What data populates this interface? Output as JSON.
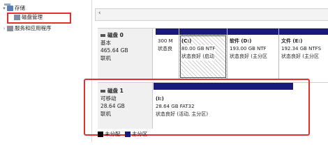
{
  "tree": {
    "items": [
      {
        "label": "存储"
      },
      {
        "label": "磁盘管理"
      },
      {
        "label": "服务和应用程序"
      }
    ]
  },
  "disks": [
    {
      "name": "磁盘 0",
      "type": "基本",
      "size": "465.64 GB",
      "status": "联机",
      "partitions": [
        {
          "title": "",
          "line1": "300 M",
          "line2": "状态良"
        },
        {
          "title": "(C:)",
          "line1": "80.00 GB NTF",
          "line2": "状态良好 (启动"
        },
        {
          "title": "软件 (D:)",
          "line1": "193.00 GB NTF",
          "line2": "状态良好 (主分区"
        },
        {
          "title": "文件 (E:)",
          "line1": "192.34 GB NTFS",
          "line2": "状态良好 (主分区"
        }
      ]
    },
    {
      "name": "磁盘 1",
      "type": "可移动",
      "size": "28.64 GB",
      "status": "联机",
      "partitions": [
        {
          "title": "(I:)",
          "line1": "28.64 GB FAT32",
          "line2": "状态良好 (活动, 主分区)"
        }
      ]
    }
  ],
  "legend": {
    "unallocated": "未分配",
    "primary": "主分区"
  },
  "colors": {
    "partition_bar": "#1a1a7a",
    "highlight_border": "#e03131",
    "unallocated_swatch": "#000000",
    "primary_swatch": "#1a1a7a"
  }
}
